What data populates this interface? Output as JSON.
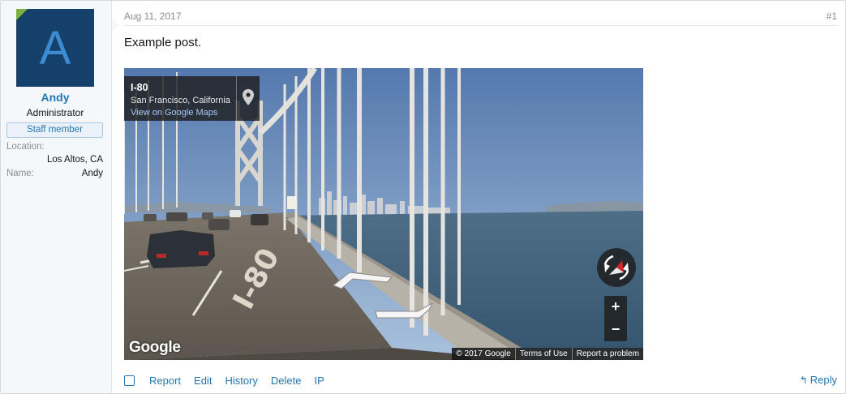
{
  "user": {
    "avatar_letter": "A",
    "username": "Andy",
    "title": "Administrator",
    "banner": "Staff member",
    "fields": [
      {
        "label": "Location:",
        "value": "Los Altos, CA"
      },
      {
        "label": "Name:",
        "value": "Andy"
      }
    ]
  },
  "post": {
    "date": "Aug 11, 2017",
    "number": "#1",
    "body": "Example post."
  },
  "embed": {
    "place_title": "I-80",
    "place_subtitle": "San Francisco, California",
    "maps_link": "View on Google Maps",
    "logo": "Google",
    "zoom_in": "+",
    "zoom_out": "−",
    "attribution": [
      "© 2017 Google",
      "Terms of Use",
      "Report a problem"
    ],
    "road_marking": "I-80"
  },
  "actions": {
    "items": [
      "Report",
      "Edit",
      "History",
      "Delete",
      "IP"
    ],
    "reply": "Reply"
  },
  "colors": {
    "link": "#2577b1",
    "avatar_bg": "#15406b",
    "sidebar_bg": "#f5f8fa",
    "online": "#7cb33c"
  }
}
